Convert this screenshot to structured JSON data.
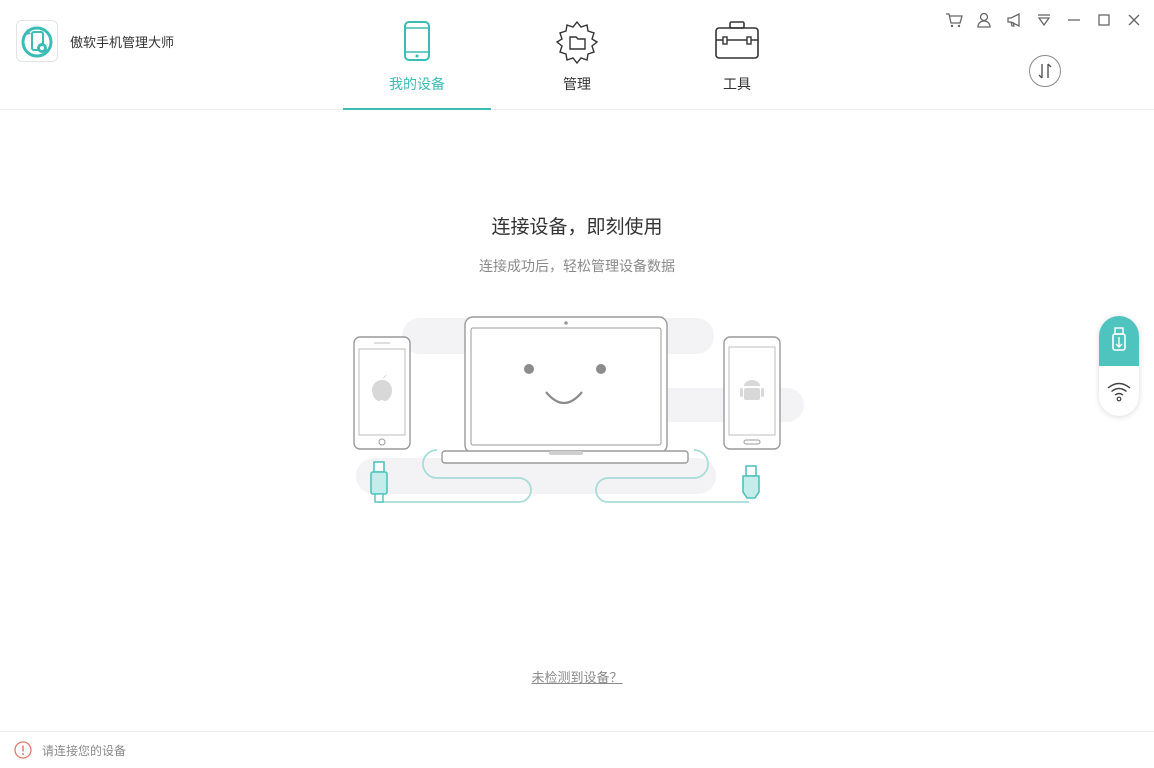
{
  "app": {
    "title": "傲软手机管理大师"
  },
  "tabs": [
    {
      "label": "我的设备",
      "active": true,
      "icon": "phone-icon"
    },
    {
      "label": "管理",
      "active": false,
      "icon": "folder-gear-icon"
    },
    {
      "label": "工具",
      "active": false,
      "icon": "toolbox-icon"
    }
  ],
  "window_controls": [
    "cart-icon",
    "user-icon",
    "megaphone-icon",
    "menu-icon",
    "minimize-icon",
    "maximize-icon",
    "close-icon"
  ],
  "main": {
    "headline": "连接设备，即刻使用",
    "subline": "连接成功后，轻松管理设备数据",
    "help_link": "未检测到设备？"
  },
  "status": {
    "text": "请连接您的设备"
  },
  "colors": {
    "accent": "#3bbcb6",
    "usb_panel": "#4fc3bd",
    "text_muted": "#8a8a8a",
    "warning": "#e07a6a"
  }
}
